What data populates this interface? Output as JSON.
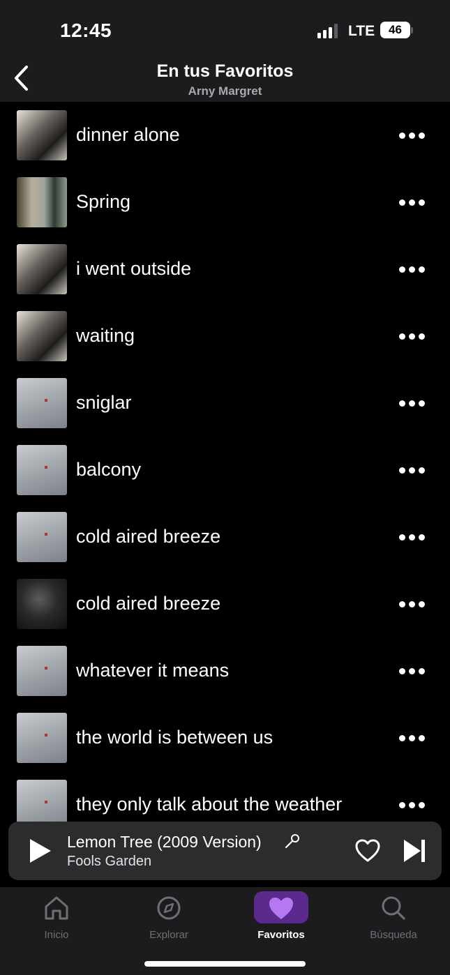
{
  "status_bar": {
    "time": "12:45",
    "network": "LTE",
    "battery": "46"
  },
  "header": {
    "title": "En tus Favoritos",
    "subtitle": "Arny Margret"
  },
  "tracks": [
    {
      "title": "dinner alone",
      "art": "room"
    },
    {
      "title": "Spring",
      "art": "duo"
    },
    {
      "title": "i went outside",
      "art": "room"
    },
    {
      "title": "waiting",
      "art": "room"
    },
    {
      "title": "sniglar",
      "art": "snow"
    },
    {
      "title": "balcony",
      "art": "snow"
    },
    {
      "title": "cold aired breeze",
      "art": "snow"
    },
    {
      "title": "cold aired breeze",
      "art": "dark"
    },
    {
      "title": "whatever it means",
      "art": "snow"
    },
    {
      "title": "the world is between us",
      "art": "snow"
    },
    {
      "title": "they only talk about the weather",
      "art": "snow"
    }
  ],
  "now_playing": {
    "title": "Lemon Tree (2009 Version)",
    "artist": "Fools Garden"
  },
  "tabs": [
    {
      "label": "Inicio",
      "icon": "home-icon",
      "active": false
    },
    {
      "label": "Explorar",
      "icon": "compass-icon",
      "active": false
    },
    {
      "label": "Favoritos",
      "icon": "heart-icon",
      "active": true
    },
    {
      "label": "Búsqueda",
      "icon": "search-icon",
      "active": false
    }
  ],
  "colors": {
    "accent": "#5a2b8c",
    "accent_icon": "#b678f0",
    "background": "#000000",
    "bar": "#1c1c1e"
  }
}
